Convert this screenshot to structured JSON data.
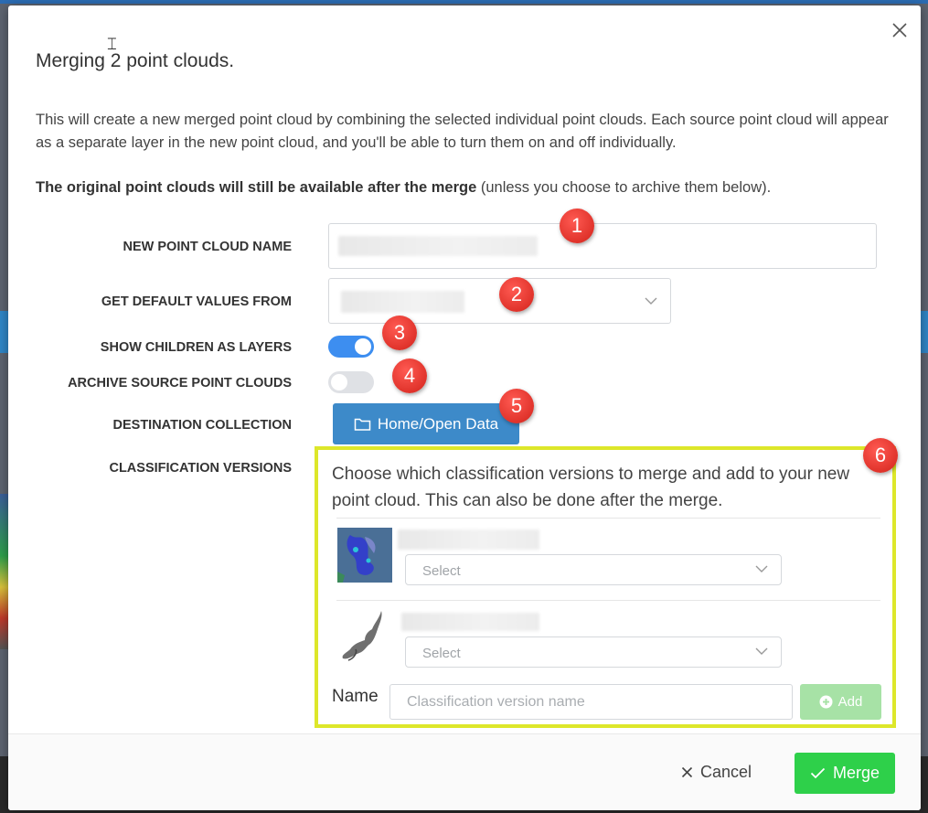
{
  "modal": {
    "title": "Merging 2 point clouds.",
    "description": "This will create a new merged point cloud by combining the selected individual point clouds. Each source point cloud will appear as a separate layer in the new point cloud, and you'll be able to turn them on and off individually.",
    "note_bold": "The original point clouds will still be available after the merge",
    "note_rest": " (unless you choose to archive them below)."
  },
  "form": {
    "name_label": "NEW POINT CLOUD NAME",
    "defaults_label": "GET DEFAULT VALUES FROM",
    "children_label": "SHOW CHILDREN AS LAYERS",
    "children_on": true,
    "archive_label": "ARCHIVE SOURCE POINT CLOUDS",
    "archive_on": false,
    "destination_label": "DESTINATION COLLECTION",
    "destination_button": "Home/Open Data",
    "classification_label": "CLASSIFICATION VERSIONS"
  },
  "classification": {
    "description": "Choose which classification versions to merge and add to your new point cloud. This can also be done after the merge.",
    "rows": [
      {
        "select_placeholder": "Select"
      },
      {
        "select_placeholder": "Select"
      }
    ],
    "name_label": "Name",
    "name_placeholder": "Classification version name",
    "add_label": "Add"
  },
  "footer": {
    "cancel_label": "Cancel",
    "merge_label": "Merge"
  },
  "annotations": [
    "1",
    "2",
    "3",
    "4",
    "5",
    "6"
  ],
  "colors": {
    "primary": "#3d8ac9",
    "toggle_on": "#3d8ef0",
    "success": "#2ed04a",
    "highlight": "#dde72a",
    "badge": "#e0332b"
  }
}
